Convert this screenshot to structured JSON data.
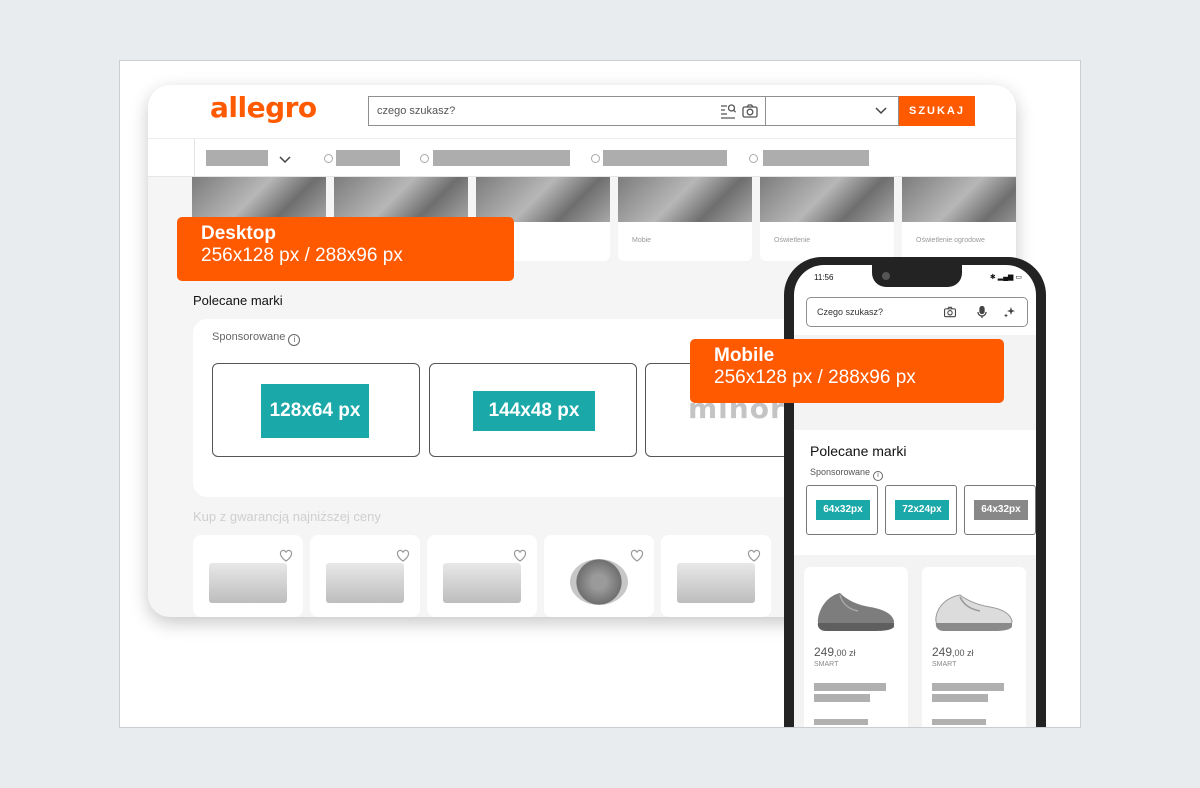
{
  "desktop": {
    "logo": "allegro",
    "search": {
      "placeholder": "czego szukasz?"
    },
    "search_button": "SZUKAJ",
    "category_tiles": [
      "",
      "Mobie",
      "Oświetlenie",
      "Oświetlenie ogrodowe"
    ],
    "section_title": "Polecane marki",
    "sponsored_label": "Sponsorowane",
    "info_glyph": "i",
    "brand_slots": [
      "128x64 px",
      "144x48 px"
    ],
    "brand_logo_partial": "minor",
    "guarantee_title": "Kup z gwarancją najniższej ceny",
    "callout": {
      "title": "Desktop",
      "sizes": "256x128 px / 288x96 px"
    }
  },
  "mobile": {
    "status_time": "11:56",
    "search": {
      "placeholder": "Czego szukasz?"
    },
    "section_title": "Polecane marki",
    "sponsored_label": "Sponsorowane",
    "info_glyph": "i",
    "brand_slots": [
      {
        "label": "64x32px",
        "color": "#1aa8a9"
      },
      {
        "label": "72x24px",
        "color": "#1aa8a9"
      },
      {
        "label": "64x32px",
        "color": "#888888"
      }
    ],
    "products": [
      {
        "price_main": "249",
        "price_decimals": ",00 zł",
        "tag": "SMART"
      },
      {
        "price_main": "249",
        "price_decimals": ",00 zł",
        "tag": "SMART"
      }
    ],
    "callout": {
      "title": "Mobile",
      "sizes": "256x128 px / 288x96 px"
    }
  },
  "colors": {
    "accent": "#ff5a00",
    "slot_teal": "#1aa8a9",
    "slot_gray": "#888888"
  },
  "icons": [
    "image-search-icon",
    "camera-icon",
    "chevron-down-icon",
    "info-icon",
    "heart-icon",
    "microphone-icon",
    "sparkle-icon"
  ]
}
